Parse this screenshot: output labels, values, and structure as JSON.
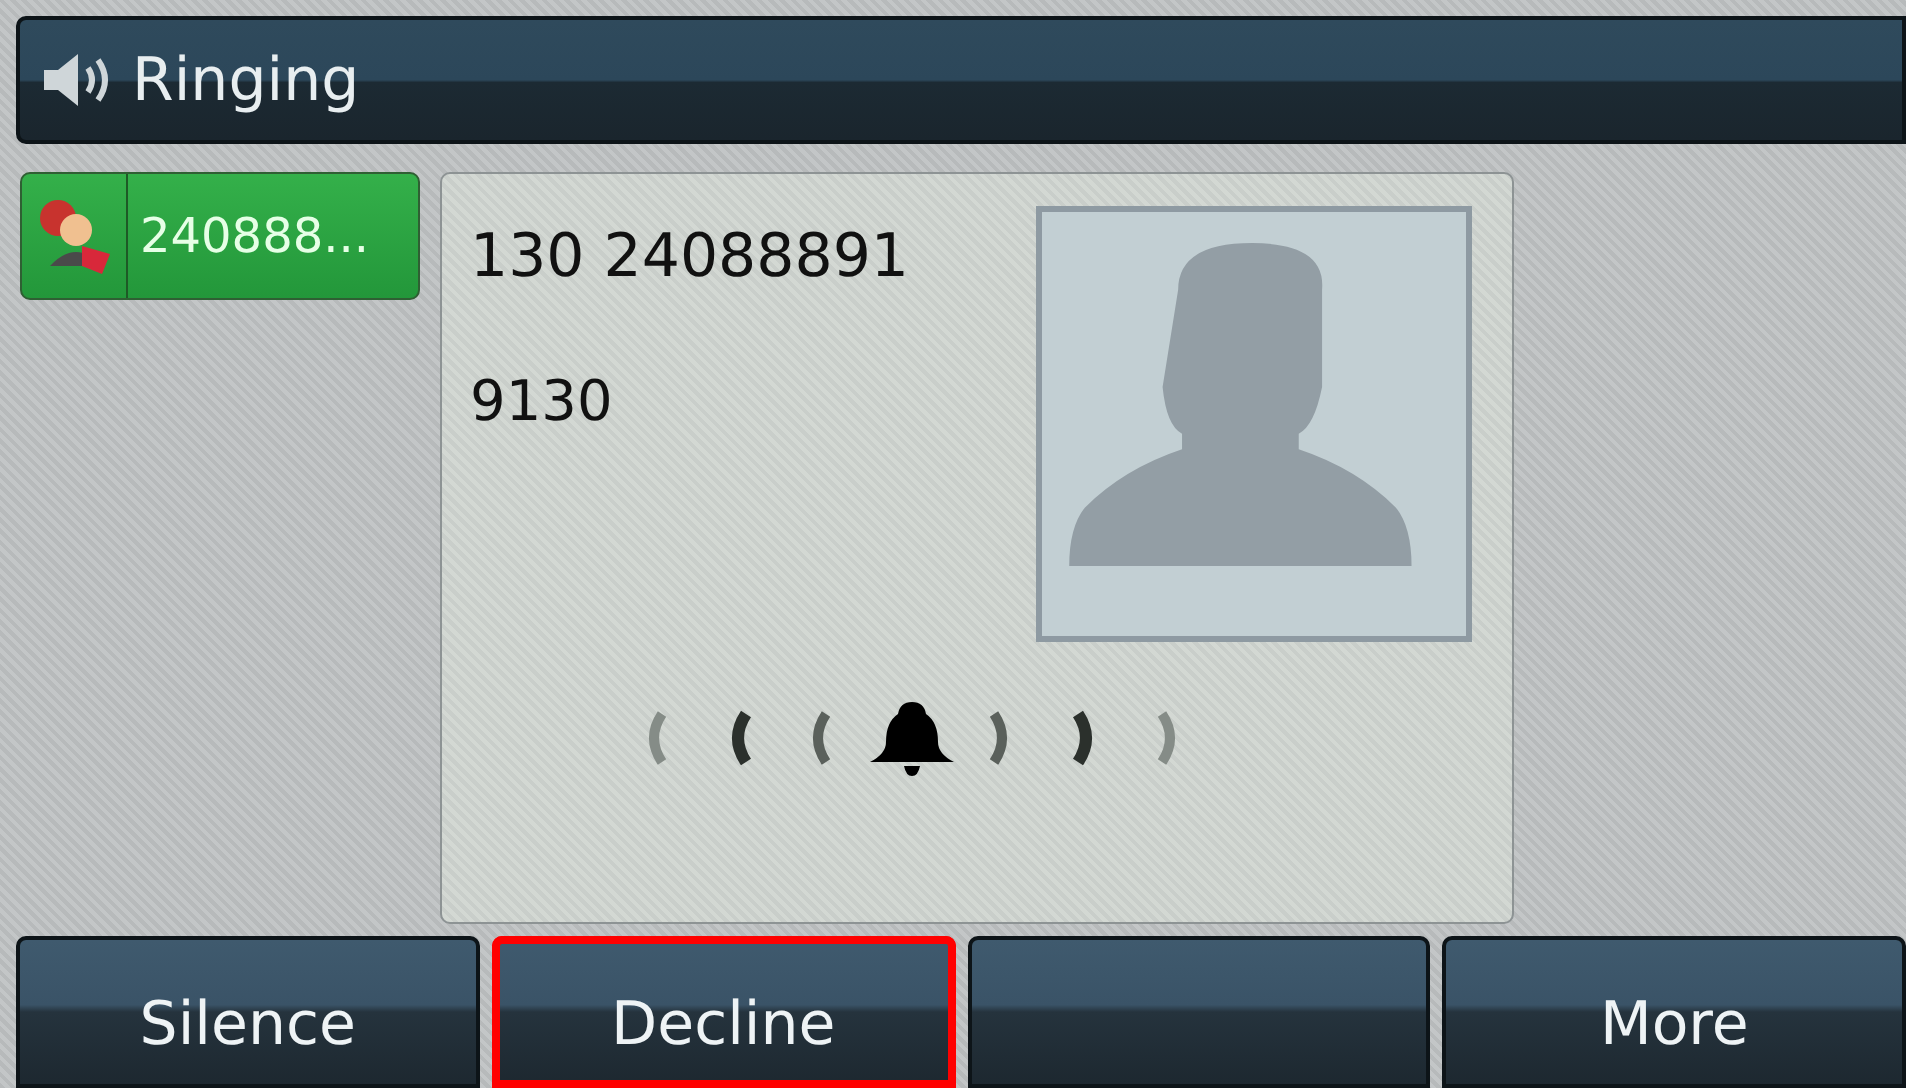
{
  "title_bar": {
    "title": "Ringing"
  },
  "calls": [
    {
      "label": "240888...",
      "selected": true
    }
  ],
  "caller": {
    "number": "130 24088891",
    "line": "9130"
  },
  "softkeys": [
    {
      "label": "Silence",
      "highlighted": false
    },
    {
      "label": "Decline",
      "highlighted": true
    },
    {
      "highlighted": false
    },
    {
      "label": "More",
      "highlighted": false
    }
  ]
}
